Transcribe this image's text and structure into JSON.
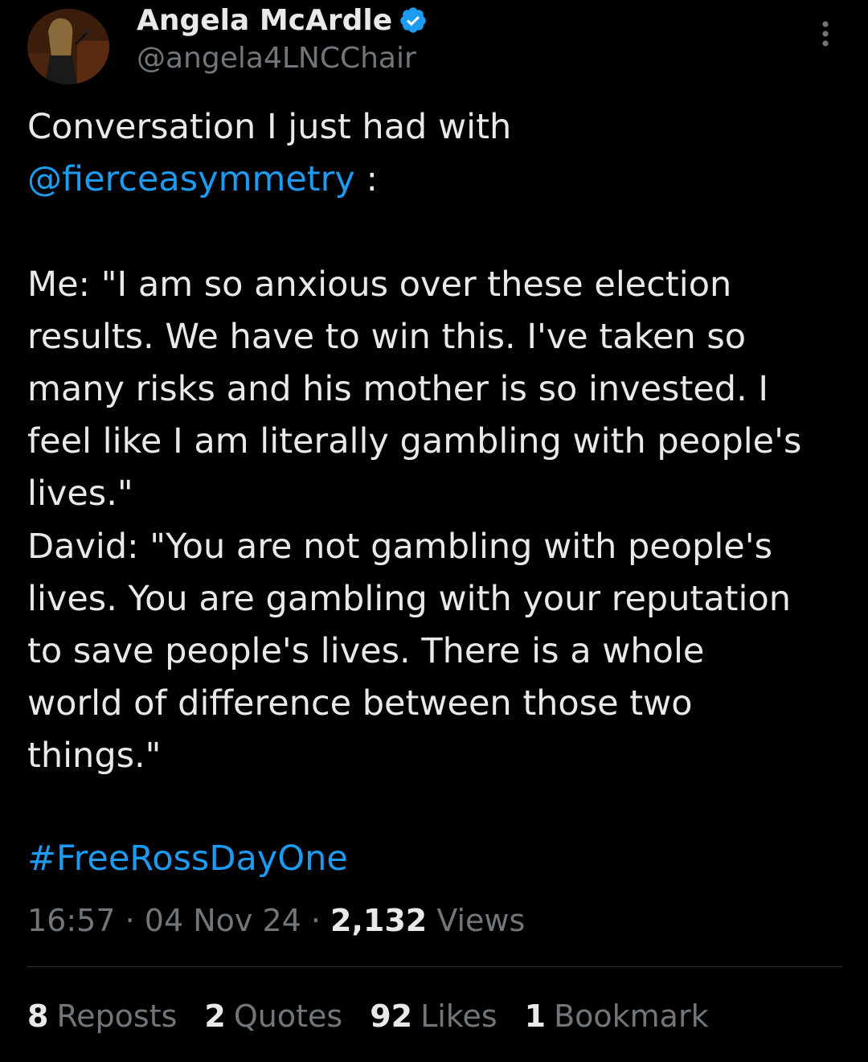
{
  "author": {
    "display_name": "Angela McArdle",
    "handle": "@angela4LNCChair",
    "verified_icon": "verified-badge-icon",
    "avatar": "avatar"
  },
  "tweet": {
    "line1": "Conversation I just had with",
    "mention": "@fierceasymmetry",
    "mention_suffix": " :",
    "body_lines": [
      "Me: \"I am so anxious over these election",
      "results. We have to win this. I've taken so",
      "many risks and his mother is so invested. I",
      "feel like I am literally gambling with people's",
      "lives.\"",
      "David: \"You are not gambling with people's",
      "lives. You are gambling with your reputation",
      "to save people's lives. There is a whole",
      "world of difference between those two",
      "things.\""
    ],
    "hashtag": "#FreeRossDayOne"
  },
  "meta": {
    "time": "16:57",
    "sep1": " · ",
    "date": "04 Nov 24",
    "sep2": " · ",
    "views_count": "2,132",
    "views_label": " Views"
  },
  "stats": {
    "reposts_count": "8",
    "reposts_label": "Reposts",
    "quotes_count": "2",
    "quotes_label": "Quotes",
    "likes_count": "92",
    "likes_label": "Likes",
    "bookmarks_count": "1",
    "bookmarks_label": "Bookmark"
  },
  "colors": {
    "background": "#000000",
    "text": "#e7e9ea",
    "secondary": "#71767b",
    "accent": "#1d9bf0",
    "divider": "#2f3336"
  }
}
